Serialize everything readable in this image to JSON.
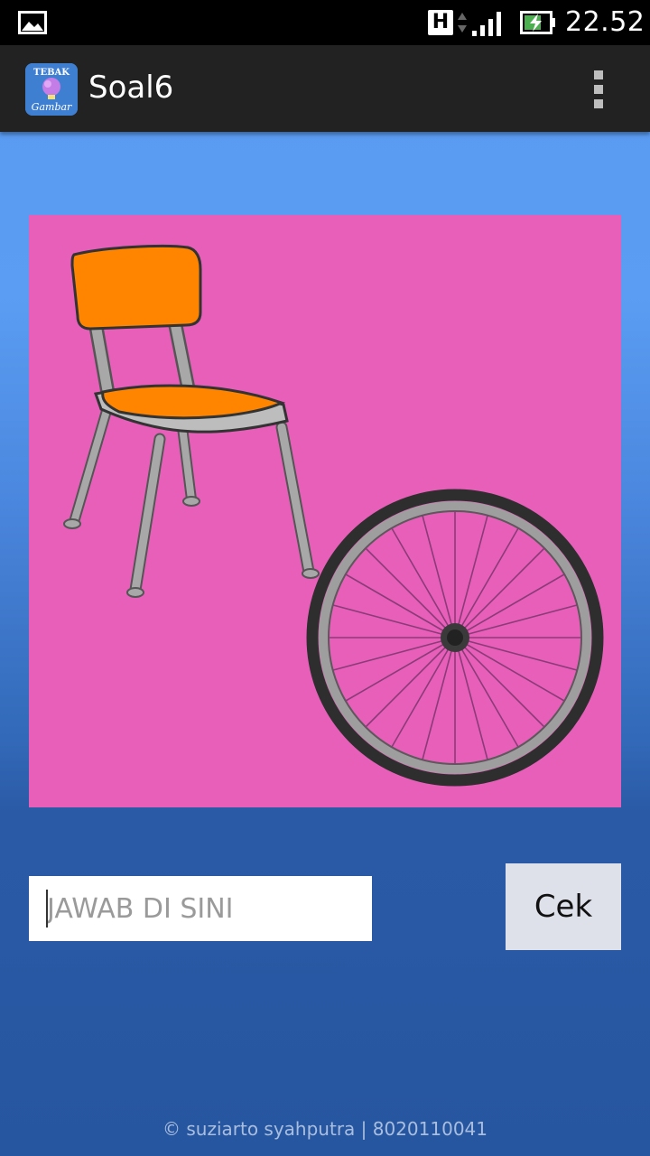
{
  "status_bar": {
    "time": "22.52",
    "network_badge": "H",
    "icons": [
      "gallery-icon",
      "data-arrows-icon",
      "signal-icon",
      "battery-charging-icon"
    ]
  },
  "action_bar": {
    "title": "Soal6",
    "app_icon": {
      "name": "tebak-gambar-app-icon",
      "line1": "TEBAK",
      "line2": "Gambar"
    },
    "menu_icon": "overflow-menu-icon"
  },
  "puzzle": {
    "image_contents": [
      "chair",
      "bicycle-wheel"
    ],
    "background_color": "#e85fba"
  },
  "answer": {
    "placeholder": "JAWAB DI SINI",
    "value": ""
  },
  "check_button": {
    "label": "Cek"
  },
  "footer": {
    "text": "© suziarto syahputra  |  8020110041"
  },
  "colors": {
    "status_bar": "#000000",
    "action_bar": "#222222",
    "chair_orange": "#ff8400",
    "button_bg": "#dfe1ea"
  }
}
